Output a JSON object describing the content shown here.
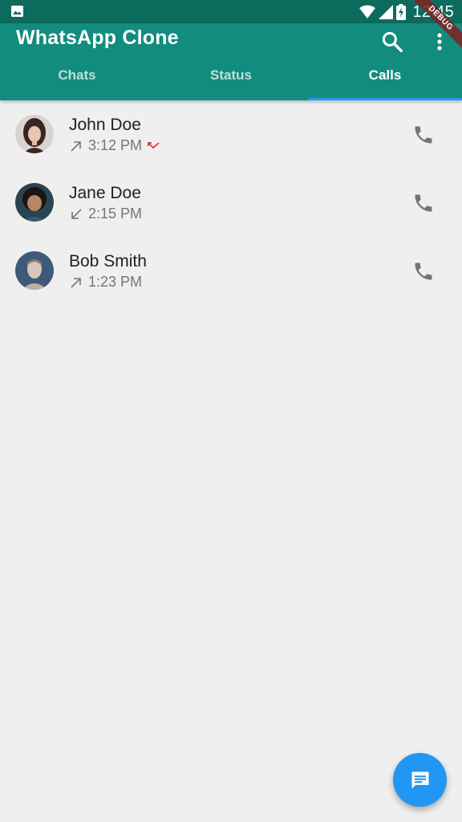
{
  "status_bar": {
    "time": "12:45",
    "icons": [
      "gallery-icon",
      "wifi-icon",
      "signal-icon",
      "battery-charging-icon"
    ]
  },
  "app_bar": {
    "title": "WhatsApp Clone",
    "search_icon": "search-icon",
    "more_icon": "more-vert-icon"
  },
  "tabs": [
    {
      "label": "Chats",
      "active": false
    },
    {
      "label": "Status",
      "active": false
    },
    {
      "label": "Calls",
      "active": true
    }
  ],
  "debug_banner": "DEBUG",
  "calls": [
    {
      "name": "John Doe",
      "time": "3:12 PM",
      "direction": "outgoing",
      "missed": true
    },
    {
      "name": "Jane Doe",
      "time": "2:15 PM",
      "direction": "incoming",
      "missed": false
    },
    {
      "name": "Bob Smith",
      "time": "1:23 PM",
      "direction": "outgoing",
      "missed": false
    }
  ],
  "fab": {
    "icon": "message-icon"
  },
  "colors": {
    "status_bar": "#0d6b5e",
    "app_bar": "#128c7e",
    "tab_indicator": "#2196f3",
    "fab": "#2196f3",
    "missed": "#e53935",
    "background": "#efefef"
  }
}
